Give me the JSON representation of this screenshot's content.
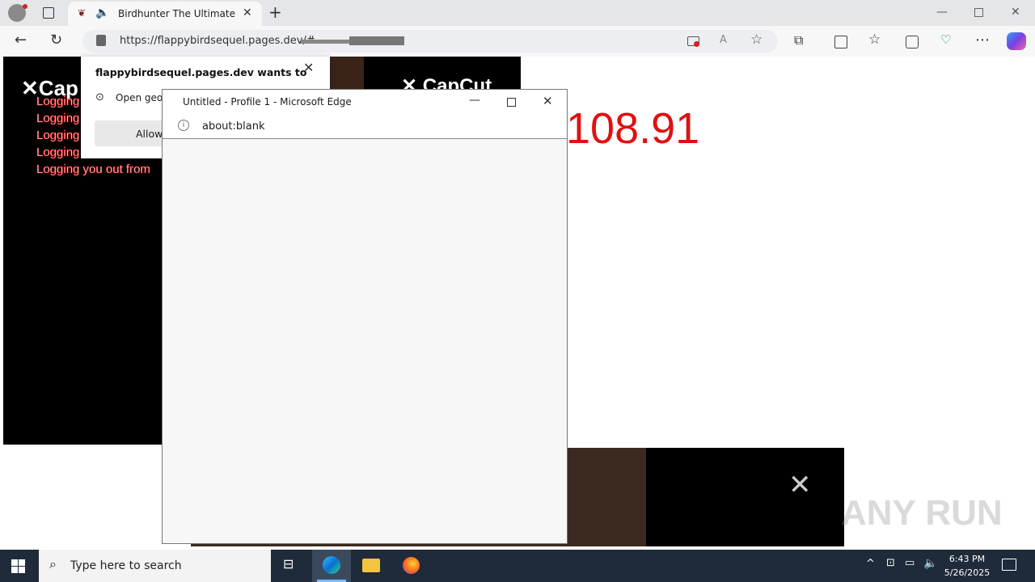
{
  "browser": {
    "tab_title": "Birdhunter The Ultimate Gar",
    "url": "https://flappybirdsequel.pages.dev/#",
    "icons": [
      "profile-icon",
      "tab-actions-icon",
      "back-icon",
      "refresh-icon",
      "lock-icon",
      "read-aloud-icon",
      "favorite-icon",
      "extensions-icon",
      "split-icon",
      "favorites-icon",
      "collections-icon",
      "performance-icon",
      "more-icon",
      "copilot-icon"
    ]
  },
  "permission_prompt": {
    "title": "flappybirdsequel.pages.dev wants to",
    "item": "Open geo l",
    "allow_label": "Allow"
  },
  "page": {
    "brand": "CapCut",
    "brand_partial": "Cap",
    "logging_lines": [
      "Logging",
      "Logging",
      "Logging",
      "Logging",
      "Logging you out from"
    ],
    "big_number": "108.91",
    "watermark": "ANY RUN"
  },
  "popup": {
    "title": "Untitled - Profile 1 - Microsoft Edge",
    "url": "about:blank"
  },
  "taskbar": {
    "search_placeholder": "Type here to search",
    "time": "6:43 PM",
    "date": "5/26/2025"
  }
}
